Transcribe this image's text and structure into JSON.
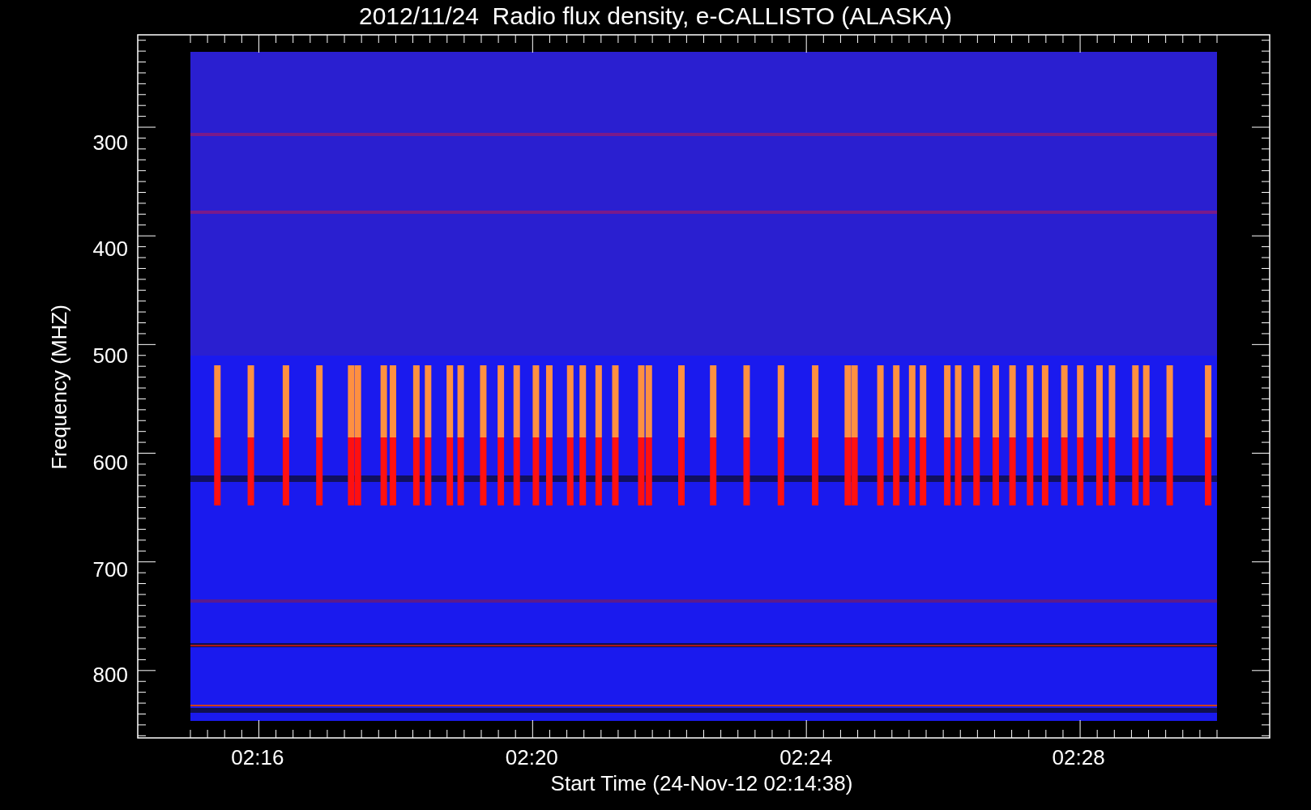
{
  "title": "2012/11/24  Radio flux density, e-CALLISTO (ALASKA)",
  "y_axis": {
    "label": "Frequency (MHZ)",
    "ticks": [
      "300",
      "400",
      "500",
      "600",
      "700",
      "800"
    ]
  },
  "x_axis": {
    "label": "Start Time (24-Nov-12 02:14:38)",
    "ticks": [
      "02:16",
      "02:20",
      "02:24",
      "02:28"
    ]
  }
}
